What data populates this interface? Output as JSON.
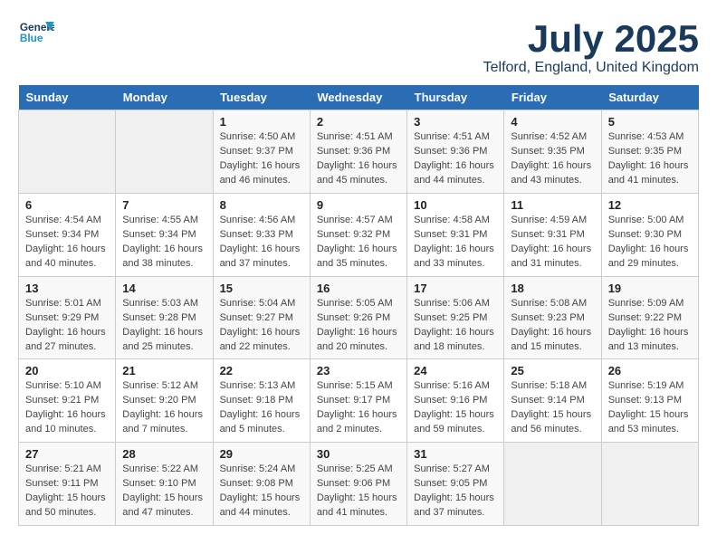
{
  "header": {
    "logo_line1": "General",
    "logo_line2": "Blue",
    "month_year": "July 2025",
    "location": "Telford, England, United Kingdom"
  },
  "weekdays": [
    "Sunday",
    "Monday",
    "Tuesday",
    "Wednesday",
    "Thursday",
    "Friday",
    "Saturday"
  ],
  "weeks": [
    [
      {
        "day": "",
        "info": ""
      },
      {
        "day": "",
        "info": ""
      },
      {
        "day": "1",
        "info": "Sunrise: 4:50 AM\nSunset: 9:37 PM\nDaylight: 16 hours\nand 46 minutes."
      },
      {
        "day": "2",
        "info": "Sunrise: 4:51 AM\nSunset: 9:36 PM\nDaylight: 16 hours\nand 45 minutes."
      },
      {
        "day": "3",
        "info": "Sunrise: 4:51 AM\nSunset: 9:36 PM\nDaylight: 16 hours\nand 44 minutes."
      },
      {
        "day": "4",
        "info": "Sunrise: 4:52 AM\nSunset: 9:35 PM\nDaylight: 16 hours\nand 43 minutes."
      },
      {
        "day": "5",
        "info": "Sunrise: 4:53 AM\nSunset: 9:35 PM\nDaylight: 16 hours\nand 41 minutes."
      }
    ],
    [
      {
        "day": "6",
        "info": "Sunrise: 4:54 AM\nSunset: 9:34 PM\nDaylight: 16 hours\nand 40 minutes."
      },
      {
        "day": "7",
        "info": "Sunrise: 4:55 AM\nSunset: 9:34 PM\nDaylight: 16 hours\nand 38 minutes."
      },
      {
        "day": "8",
        "info": "Sunrise: 4:56 AM\nSunset: 9:33 PM\nDaylight: 16 hours\nand 37 minutes."
      },
      {
        "day": "9",
        "info": "Sunrise: 4:57 AM\nSunset: 9:32 PM\nDaylight: 16 hours\nand 35 minutes."
      },
      {
        "day": "10",
        "info": "Sunrise: 4:58 AM\nSunset: 9:31 PM\nDaylight: 16 hours\nand 33 minutes."
      },
      {
        "day": "11",
        "info": "Sunrise: 4:59 AM\nSunset: 9:31 PM\nDaylight: 16 hours\nand 31 minutes."
      },
      {
        "day": "12",
        "info": "Sunrise: 5:00 AM\nSunset: 9:30 PM\nDaylight: 16 hours\nand 29 minutes."
      }
    ],
    [
      {
        "day": "13",
        "info": "Sunrise: 5:01 AM\nSunset: 9:29 PM\nDaylight: 16 hours\nand 27 minutes."
      },
      {
        "day": "14",
        "info": "Sunrise: 5:03 AM\nSunset: 9:28 PM\nDaylight: 16 hours\nand 25 minutes."
      },
      {
        "day": "15",
        "info": "Sunrise: 5:04 AM\nSunset: 9:27 PM\nDaylight: 16 hours\nand 22 minutes."
      },
      {
        "day": "16",
        "info": "Sunrise: 5:05 AM\nSunset: 9:26 PM\nDaylight: 16 hours\nand 20 minutes."
      },
      {
        "day": "17",
        "info": "Sunrise: 5:06 AM\nSunset: 9:25 PM\nDaylight: 16 hours\nand 18 minutes."
      },
      {
        "day": "18",
        "info": "Sunrise: 5:08 AM\nSunset: 9:23 PM\nDaylight: 16 hours\nand 15 minutes."
      },
      {
        "day": "19",
        "info": "Sunrise: 5:09 AM\nSunset: 9:22 PM\nDaylight: 16 hours\nand 13 minutes."
      }
    ],
    [
      {
        "day": "20",
        "info": "Sunrise: 5:10 AM\nSunset: 9:21 PM\nDaylight: 16 hours\nand 10 minutes."
      },
      {
        "day": "21",
        "info": "Sunrise: 5:12 AM\nSunset: 9:20 PM\nDaylight: 16 hours\nand 7 minutes."
      },
      {
        "day": "22",
        "info": "Sunrise: 5:13 AM\nSunset: 9:18 PM\nDaylight: 16 hours\nand 5 minutes."
      },
      {
        "day": "23",
        "info": "Sunrise: 5:15 AM\nSunset: 9:17 PM\nDaylight: 16 hours\nand 2 minutes."
      },
      {
        "day": "24",
        "info": "Sunrise: 5:16 AM\nSunset: 9:16 PM\nDaylight: 15 hours\nand 59 minutes."
      },
      {
        "day": "25",
        "info": "Sunrise: 5:18 AM\nSunset: 9:14 PM\nDaylight: 15 hours\nand 56 minutes."
      },
      {
        "day": "26",
        "info": "Sunrise: 5:19 AM\nSunset: 9:13 PM\nDaylight: 15 hours\nand 53 minutes."
      }
    ],
    [
      {
        "day": "27",
        "info": "Sunrise: 5:21 AM\nSunset: 9:11 PM\nDaylight: 15 hours\nand 50 minutes."
      },
      {
        "day": "28",
        "info": "Sunrise: 5:22 AM\nSunset: 9:10 PM\nDaylight: 15 hours\nand 47 minutes."
      },
      {
        "day": "29",
        "info": "Sunrise: 5:24 AM\nSunset: 9:08 PM\nDaylight: 15 hours\nand 44 minutes."
      },
      {
        "day": "30",
        "info": "Sunrise: 5:25 AM\nSunset: 9:06 PM\nDaylight: 15 hours\nand 41 minutes."
      },
      {
        "day": "31",
        "info": "Sunrise: 5:27 AM\nSunset: 9:05 PM\nDaylight: 15 hours\nand 37 minutes."
      },
      {
        "day": "",
        "info": ""
      },
      {
        "day": "",
        "info": ""
      }
    ]
  ]
}
